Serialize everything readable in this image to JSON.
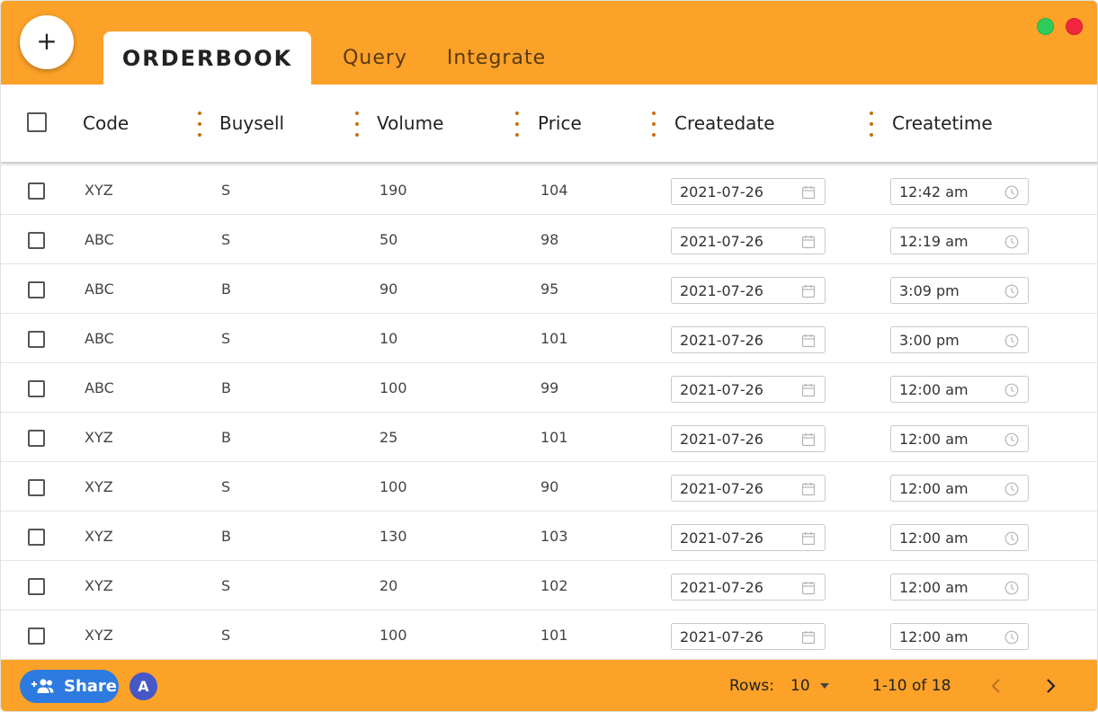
{
  "header": {
    "add_label": "+",
    "tabs": [
      {
        "label": "ORDERBOOK"
      },
      {
        "label": "Query"
      },
      {
        "label": "Integrate"
      }
    ]
  },
  "colors": {
    "accent": "#fda228",
    "window_green": "#2ecc5a",
    "window_red": "#f2263d",
    "share_blue": "#2d7ae0",
    "avatar_indigo": "#4658c8",
    "column_menu_dots": "#c76f12"
  },
  "table": {
    "columns": [
      "Code",
      "Buysell",
      "Volume",
      "Price",
      "Createdate",
      "Createtime"
    ],
    "rows": [
      {
        "code": "XYZ",
        "buysell": "S",
        "volume": "190",
        "price": "104",
        "date": "2021-07-26",
        "time": "12:42 am"
      },
      {
        "code": "ABC",
        "buysell": "S",
        "volume": "50",
        "price": "98",
        "date": "2021-07-26",
        "time": "12:19 am"
      },
      {
        "code": "ABC",
        "buysell": "B",
        "volume": "90",
        "price": "95",
        "date": "2021-07-26",
        "time": "3:09 pm"
      },
      {
        "code": "ABC",
        "buysell": "S",
        "volume": "10",
        "price": "101",
        "date": "2021-07-26",
        "time": "3:00 pm"
      },
      {
        "code": "ABC",
        "buysell": "B",
        "volume": "100",
        "price": "99",
        "date": "2021-07-26",
        "time": "12:00 am"
      },
      {
        "code": "XYZ",
        "buysell": "B",
        "volume": "25",
        "price": "101",
        "date": "2021-07-26",
        "time": "12:00 am"
      },
      {
        "code": "XYZ",
        "buysell": "S",
        "volume": "100",
        "price": "90",
        "date": "2021-07-26",
        "time": "12:00 am"
      },
      {
        "code": "XYZ",
        "buysell": "B",
        "volume": "130",
        "price": "103",
        "date": "2021-07-26",
        "time": "12:00 am"
      },
      {
        "code": "XYZ",
        "buysell": "S",
        "volume": "20",
        "price": "102",
        "date": "2021-07-26",
        "time": "12:00 am"
      },
      {
        "code": "XYZ",
        "buysell": "S",
        "volume": "100",
        "price": "101",
        "date": "2021-07-26",
        "time": "12:00 am"
      }
    ]
  },
  "icons": {
    "add": "plus-icon",
    "column_menu": "vertical-dots-icon",
    "date": "calendar-icon",
    "time": "clock-icon",
    "share": "add-people-icon",
    "rows_dropdown": "caret-down-icon",
    "prev": "chevron-left-icon",
    "next": "chevron-right-icon"
  },
  "footer": {
    "share_label": "Share",
    "avatar_initial": "A",
    "rows_label": "Rows:",
    "rows_value": "10",
    "range_label": "1-10 of 18"
  }
}
